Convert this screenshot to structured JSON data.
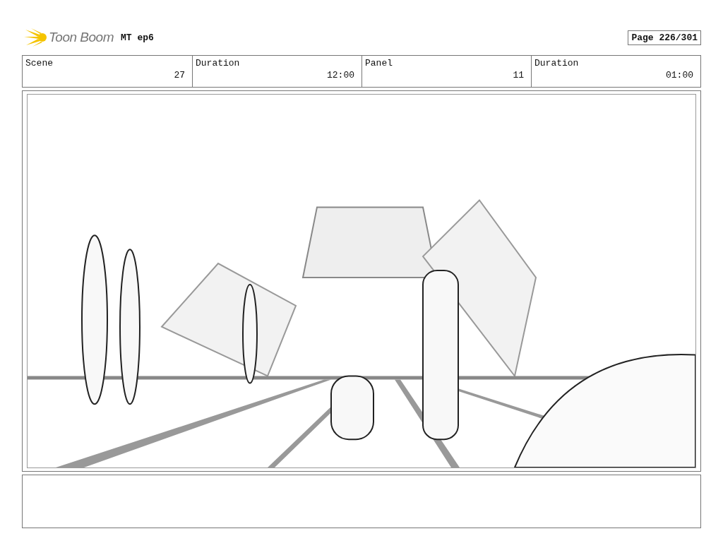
{
  "header": {
    "logo": "Toon Boom",
    "project": "MT ep6",
    "page": "Page 226/301"
  },
  "fields": [
    {
      "label": "Scene",
      "value": "27"
    },
    {
      "label": "Duration",
      "value": "12:00"
    },
    {
      "label": "Panel",
      "value": "11"
    },
    {
      "label": "Duration",
      "value": "01:00"
    }
  ]
}
